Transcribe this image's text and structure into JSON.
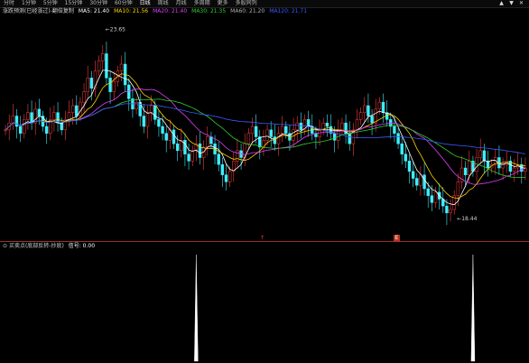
{
  "toolbar": {
    "tabs": [
      "分时",
      "1分钟",
      "5分钟",
      "15分钟",
      "30分钟",
      "60分钟",
      "日线",
      "周线",
      "月线",
      "多周期",
      "更多"
    ],
    "active_index": 6,
    "extra": "多股同列",
    "window_controls": [
      "▲",
      "▼",
      "✕"
    ]
  },
  "legend": {
    "indicator": "涨跌预测(已经涨过)-翻倍复制",
    "ma": [
      {
        "label": "MA5: 21.40",
        "color": "#ffffff"
      },
      {
        "label": "MA10: 21.56",
        "color": "#ffd400"
      },
      {
        "label": "MA20: 21.40",
        "color": "#e040fb"
      },
      {
        "label": "MA30: 21.35",
        "color": "#31d031"
      },
      {
        "label": "MA60: 21.20",
        "color": "#b0b0b0"
      },
      {
        "label": "MA120: 21.71",
        "color": "#3b5bff"
      }
    ]
  },
  "price_labels": {
    "high": "23.65",
    "low": "18.44"
  },
  "markers": {
    "left": "↑",
    "right": "E"
  },
  "sub_legend": {
    "title": "买卖点(底部反转-抄底)",
    "value_label": "信号: 0.00"
  },
  "colors": {
    "up": "#ff3b3b",
    "down": "#3cf0ff",
    "ma5": "#ffffff",
    "ma10": "#ffd400",
    "ma20": "#e040fb",
    "ma30": "#31d031",
    "ma120": "#3b5bff",
    "divider": "#9a2f2f"
  },
  "chart_data": {
    "type": "candlestick",
    "ylim": [
      18.0,
      24.0
    ],
    "high_marker": {
      "index": 26,
      "value": 23.65
    },
    "low_marker": {
      "index": 120,
      "value": 18.44
    },
    "closes": [
      20.9,
      21.1,
      21.3,
      21.0,
      20.8,
      21.2,
      21.4,
      21.1,
      21.5,
      21.3,
      21.0,
      20.8,
      21.2,
      21.4,
      21.1,
      20.9,
      21.2,
      21.4,
      21.6,
      21.3,
      21.7,
      22.0,
      22.4,
      22.1,
      22.6,
      22.9,
      23.1,
      22.4,
      22.0,
      22.3,
      22.6,
      22.8,
      22.2,
      21.8,
      21.5,
      21.7,
      21.3,
      21.0,
      21.4,
      21.6,
      21.2,
      21.0,
      20.8,
      20.6,
      20.9,
      20.5,
      20.3,
      20.6,
      20.2,
      20.0,
      20.3,
      20.5,
      20.1,
      20.4,
      20.7,
      20.5,
      20.2,
      19.9,
      19.6,
      19.4,
      19.7,
      20.0,
      20.3,
      20.1,
      20.5,
      20.8,
      21.0,
      20.7,
      20.4,
      20.6,
      20.9,
      20.7,
      20.5,
      20.8,
      21.0,
      20.8,
      20.6,
      20.9,
      21.1,
      20.9,
      21.2,
      21.0,
      20.8,
      20.7,
      20.9,
      21.1,
      21.0,
      20.8,
      20.6,
      20.9,
      21.1,
      20.8,
      20.5,
      20.9,
      21.2,
      21.4,
      21.6,
      21.3,
      21.1,
      21.5,
      21.7,
      21.4,
      21.2,
      21.0,
      20.8,
      20.5,
      20.2,
      20.0,
      19.7,
      19.5,
      19.3,
      19.6,
      19.2,
      19.0,
      18.8,
      19.1,
      18.9,
      18.7,
      18.5,
      18.6,
      19.0,
      19.4,
      19.8,
      19.6,
      20.0,
      19.7,
      20.1,
      20.3,
      20.0,
      19.8,
      19.9,
      20.1,
      19.8,
      19.9,
      20.0,
      19.7,
      19.8,
      19.9,
      19.7,
      19.8
    ],
    "signals": [
      {
        "index": 51,
        "value": 1
      },
      {
        "index": 125,
        "value": 1
      }
    ]
  }
}
